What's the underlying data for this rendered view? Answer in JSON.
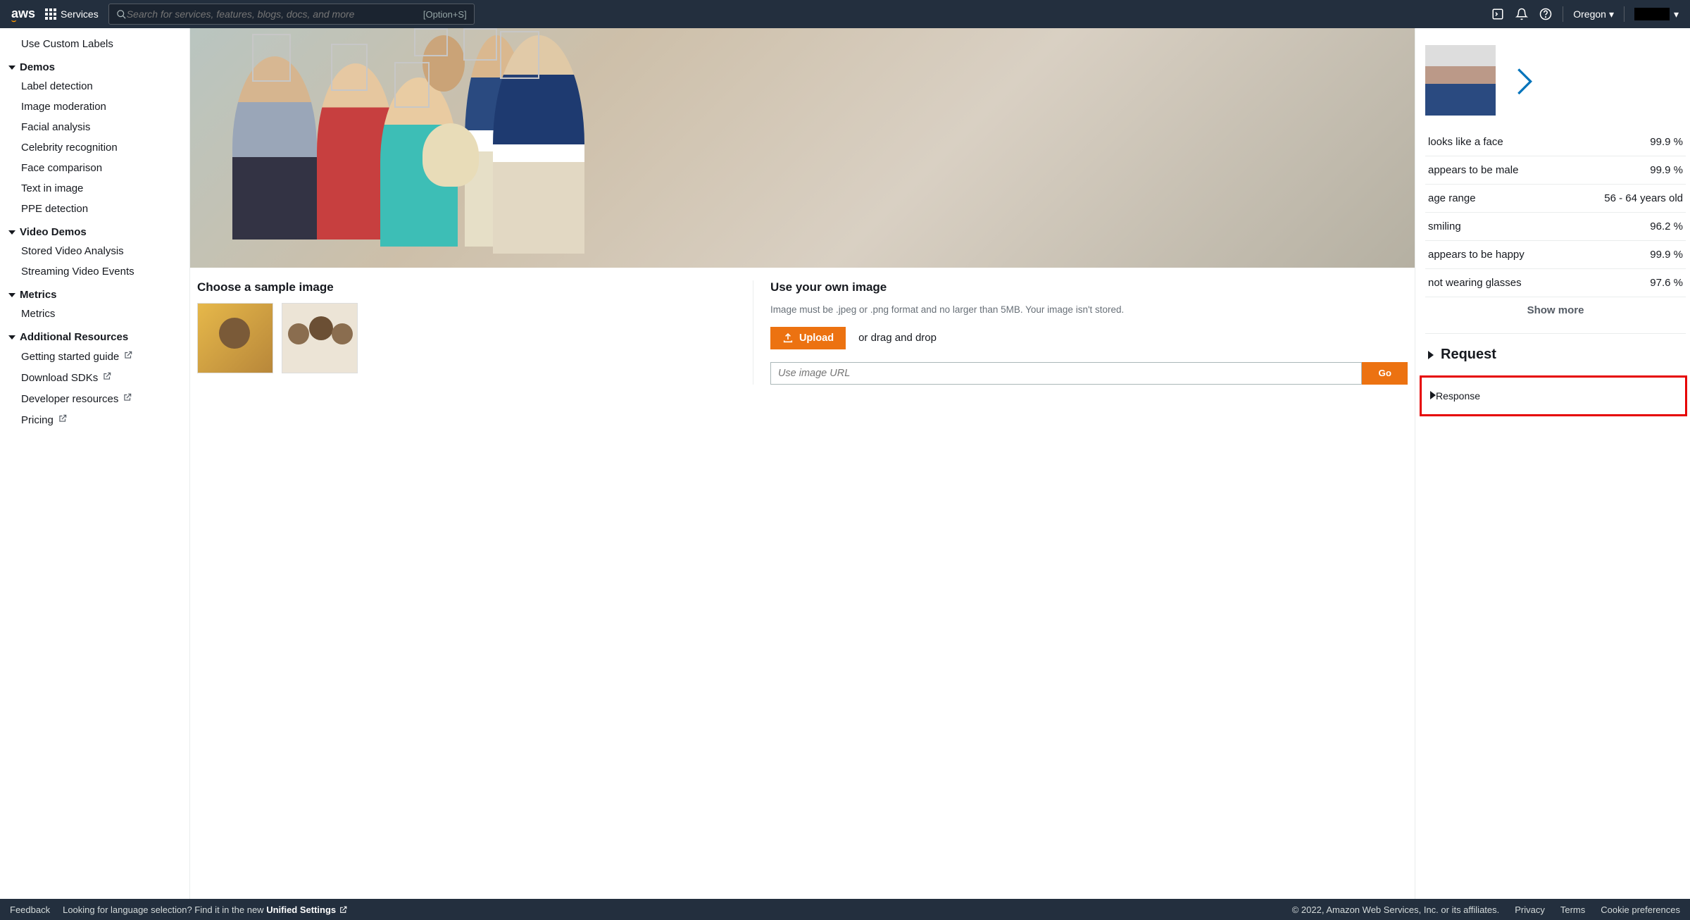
{
  "topnav": {
    "services": "Services",
    "search_placeholder": "Search for services, features, blogs, docs, and more",
    "search_kbd": "[Option+S]",
    "region": "Oregon"
  },
  "sidebar": {
    "top_item": "Use Custom Labels",
    "groups": [
      {
        "label": "Demos",
        "items": [
          "Label detection",
          "Image moderation",
          "Facial analysis",
          "Celebrity recognition",
          "Face comparison",
          "Text in image",
          "PPE detection"
        ]
      },
      {
        "label": "Video Demos",
        "items": [
          "Stored Video Analysis",
          "Streaming Video Events"
        ]
      },
      {
        "label": "Metrics",
        "items": [
          "Metrics"
        ]
      },
      {
        "label": "Additional Resources",
        "items": [
          "Getting started guide",
          "Download SDKs",
          "Developer resources",
          "Pricing"
        ],
        "external": true
      }
    ]
  },
  "center": {
    "sample_heading": "Choose a sample image",
    "own_heading": "Use your own image",
    "own_hint": "Image must be .jpeg or .png format and no larger than 5MB. Your image isn't stored.",
    "upload_label": "Upload",
    "drag_label": "or drag and drop",
    "url_placeholder": "Use image URL",
    "go_label": "Go"
  },
  "results": {
    "attrs": [
      {
        "k": "looks like a face",
        "v": "99.9 %"
      },
      {
        "k": "appears to be male",
        "v": "99.9 %"
      },
      {
        "k": "age range",
        "v": "56 - 64 years old"
      },
      {
        "k": "smiling",
        "v": "96.2 %"
      },
      {
        "k": "appears to be happy",
        "v": "99.9 %"
      },
      {
        "k": "not wearing glasses",
        "v": "97.6 %"
      }
    ],
    "show_more": "Show more",
    "request": "Request",
    "response": "Response"
  },
  "footer": {
    "feedback": "Feedback",
    "lang_prompt": "Looking for language selection? Find it in the new ",
    "unified": "Unified Settings",
    "copyright": "© 2022, Amazon Web Services, Inc. or its affiliates.",
    "privacy": "Privacy",
    "terms": "Terms",
    "cookies": "Cookie preferences"
  }
}
